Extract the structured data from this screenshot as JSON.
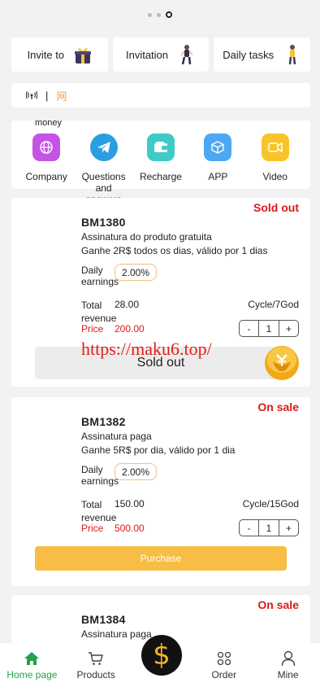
{
  "carousel": {
    "dots": 3,
    "active": 2
  },
  "quick_links": [
    {
      "label": "Invite to",
      "icon": "gift-box-icon"
    },
    {
      "label": "Invitation",
      "icon": "person-figure-icon"
    },
    {
      "label": "Daily tasks",
      "icon": "person-figure-icon"
    }
  ],
  "notice": {
    "separator": "|",
    "text": "网"
  },
  "categories": {
    "overflow_label": "money",
    "items": [
      {
        "label": "Company",
        "icon": "globe-icon",
        "color": "#c454e6"
      },
      {
        "label": "Questions and answers",
        "icon": "telegram-icon",
        "color": "#2a9ee0"
      },
      {
        "label": "Recharge",
        "icon": "wallet-icon",
        "color": "#3ecbc8"
      },
      {
        "label": "APP",
        "icon": "cube-icon",
        "color": "#4da8f2"
      },
      {
        "label": "Video",
        "icon": "video-icon",
        "color": "#f9c42a"
      }
    ]
  },
  "products": [
    {
      "name": "BM1380",
      "status": "Sold out",
      "desc1": "Assinatura do produto gratuita",
      "desc2": "Ganhe 2R$ todos os dias, válido por 1 dias",
      "earn_label": "Daily earnings",
      "earn_rate": "2.00%",
      "total_label": "Total revenue",
      "total": "28.00",
      "cycle": "Cycle/7God",
      "price_label": "Price",
      "price": "200.00",
      "qty_minus": "-",
      "qty": "1",
      "qty_plus": "+",
      "action": "Sold out"
    },
    {
      "name": "BM1382",
      "status": "On sale",
      "desc1": "Assinatura paga",
      "desc2": "Ganhe 5R$ por dia, válido por 1 dia",
      "earn_label": "Daily earnings",
      "earn_rate": "2.00%",
      "total_label": "Total revenue",
      "total": "150.00",
      "cycle": "Cycle/15God",
      "price_label": "Price",
      "price": "500.00",
      "qty_minus": "-",
      "qty": "1",
      "qty_plus": "+",
      "action": "Purchase"
    },
    {
      "name": "BM1384",
      "status": "On sale",
      "desc1": "Assinatura paga"
    }
  ],
  "watermark": "https://maku6.top/",
  "bottom_nav": [
    {
      "label": "Home page",
      "icon": "home-icon",
      "active": true
    },
    {
      "label": "Products",
      "icon": "cart-icon"
    },
    {
      "label": "",
      "icon": "dollar-coin-icon"
    },
    {
      "label": "Order",
      "icon": "grid-circles-icon"
    },
    {
      "label": "Mine",
      "icon": "user-icon"
    }
  ],
  "colors": {
    "accent": "#f7bd45",
    "status_red": "#d91a1a",
    "active_green": "#25a14a"
  }
}
